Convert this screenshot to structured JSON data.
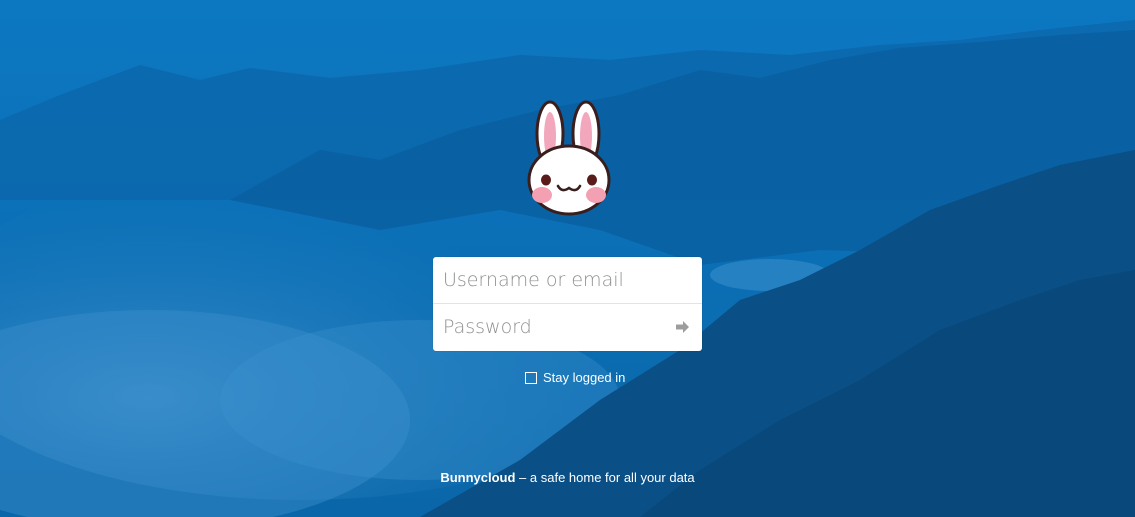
{
  "login": {
    "username_placeholder": "Username or email",
    "password_placeholder": "Password",
    "submit_icon": "arrow-right-icon"
  },
  "remember": {
    "label": "Stay logged in",
    "checked": false
  },
  "footer": {
    "brand": "Bunnycloud",
    "tagline": " – a safe home for all your data"
  },
  "logo": {
    "icon": "bunny-logo-icon"
  },
  "colors": {
    "background": "#0b6fb6",
    "background_dark": "#0a4f86",
    "bunny_ear_inner": "#f2a7bd",
    "bunny_cheek": "#f2a0b2"
  }
}
